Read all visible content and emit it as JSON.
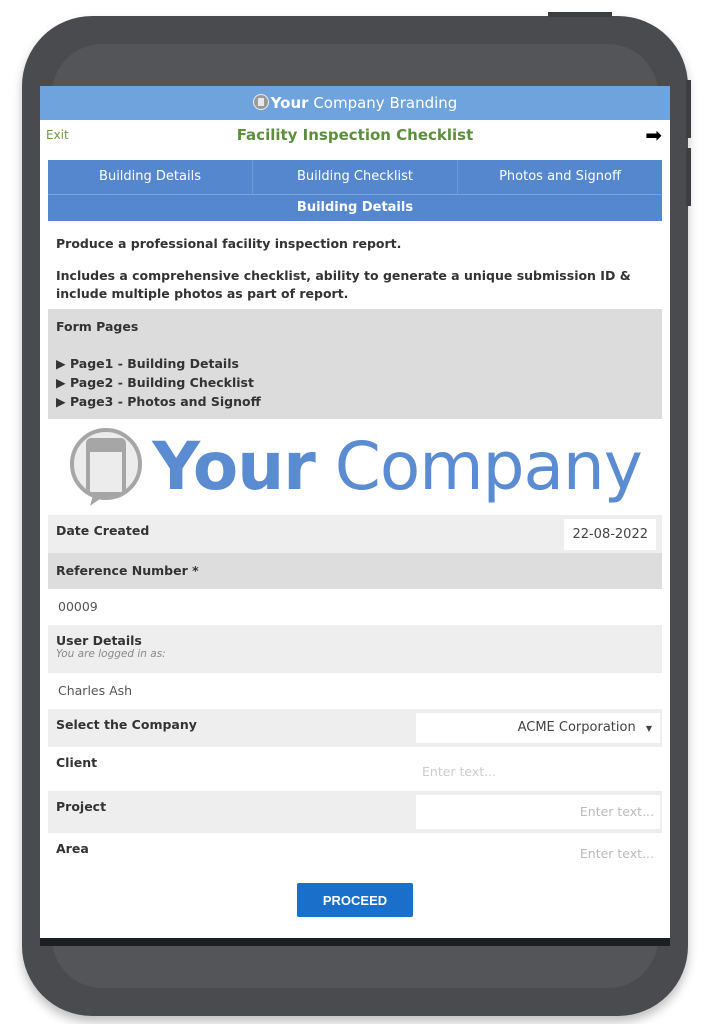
{
  "branding": {
    "bold": "Your",
    "rest": " Company Branding",
    "logo_icon": "company-logo-icon"
  },
  "header": {
    "exit_label": "Exit",
    "title": "Facility Inspection Checklist",
    "next_icon": "arrow-right-icon"
  },
  "tabs": [
    {
      "label": "Building Details"
    },
    {
      "label": "Building Checklist"
    },
    {
      "label": "Photos and Signoff"
    }
  ],
  "page_header": "Building Details",
  "intro": {
    "line1": "Produce a professional facility inspection report.",
    "line2": "Includes a comprehensive checklist, ability to generate a unique submission ID & include multiple photos as part of report."
  },
  "form_pages": {
    "title": "Form Pages",
    "items": [
      "▶ Page1 - Building Details",
      "▶ Page2 - Building Checklist",
      "▶ Page3 - Photos and Signoff"
    ]
  },
  "logo": {
    "bold": "Your",
    "rest": " Company"
  },
  "fields": {
    "date_created": {
      "label": "Date Created",
      "value": "22-08-2022"
    },
    "reference_number": {
      "label": "Reference Number *",
      "value": "00009"
    },
    "user_details": {
      "label": "User Details",
      "sublabel": "You are logged in as:",
      "value": "Charles Ash"
    },
    "company": {
      "label": "Select the Company",
      "value": "ACME Corporation"
    },
    "client": {
      "label": "Client",
      "placeholder": "Enter text..."
    },
    "project": {
      "label": "Project",
      "placeholder": "Enter text..."
    },
    "area": {
      "label": "Area",
      "placeholder": "Enter text..."
    }
  },
  "proceed_label": "PROCEED"
}
